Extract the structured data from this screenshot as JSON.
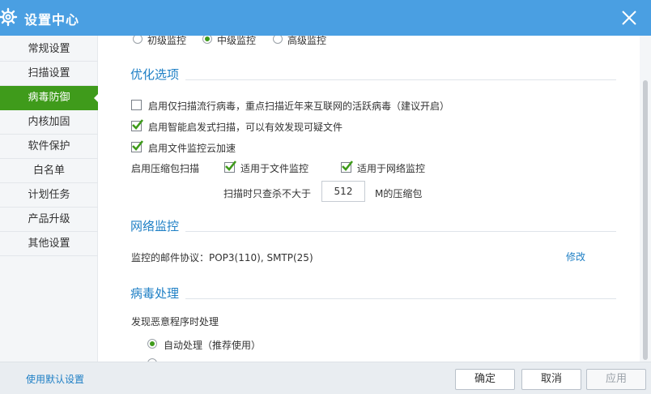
{
  "window": {
    "title": "设置中心",
    "brand_color": "#4a9fe2",
    "active_color": "#3f9b1b",
    "logo_icon": "gear-logo-icon",
    "close_icon": "close-icon"
  },
  "sidebar": {
    "items": [
      {
        "label": "常规设置",
        "active": false
      },
      {
        "label": "扫描设置",
        "active": false
      },
      {
        "label": "病毒防御",
        "active": true
      },
      {
        "label": "内核加固",
        "active": false
      },
      {
        "label": "软件保护",
        "active": false
      },
      {
        "label": "白名单",
        "active": false
      },
      {
        "label": "计划任务",
        "active": false
      },
      {
        "label": "产品升级",
        "active": false
      },
      {
        "label": "其他设置",
        "active": false
      }
    ]
  },
  "scan_level": {
    "options": [
      "初级监控",
      "中级监控",
      "高级监控"
    ],
    "selected": "中级监控"
  },
  "optimize": {
    "title": "优化选项",
    "opt1": {
      "label": "启用仅扫描流行病毒，重点扫描近年来互联网的活跃病毒（建议开启）",
      "checked": false
    },
    "opt2": {
      "label": "启用智能启发式扫描，可以有效发现可疑文件",
      "checked": true
    },
    "opt3": {
      "label": "启用文件监控云加速",
      "checked": true
    },
    "compress_label": "启用压缩包扫描",
    "file_monitor": {
      "label": "适用于文件监控",
      "checked": true
    },
    "net_monitor": {
      "label": "适用于网络监控",
      "checked": true
    },
    "size_prefix": "扫描时只查杀不大于",
    "size_value": "512",
    "size_suffix": "M的压缩包"
  },
  "network": {
    "title": "网络监控",
    "protocol_text": "监控的邮件协议：POP3(110), SMTP(25)",
    "modify_label": "修改"
  },
  "virus": {
    "title": "病毒处理",
    "prompt": "发现恶意程序时处理",
    "auto_label": "自动处理（推荐使用）"
  },
  "footer": {
    "default_link": "使用默认设置",
    "ok_label": "确定",
    "cancel_label": "取消",
    "apply_label": "应用"
  }
}
